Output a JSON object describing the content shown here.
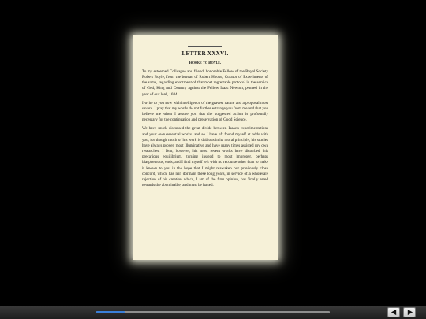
{
  "page": {
    "title": "LETTER XXXVI.",
    "subtitle": "Hooke to Boyle.",
    "paragraphs": [
      "To my esteemed Colleague and friend, honorable Fellow of the Royal Society Robert Boyle, from the bureau of Robert Hooke, Curator of Experiments of the same, regarding enactment of that most regrettable protocol in the service of God, King and Country against the Fellow Isaac Newton, penned in the year of our lord, 1684.",
      "I write to you now with intelligence of the gravest nature and a proposal most severe. I pray that my words do not further estrange you from me and that you believe me when I assure you that the suggested action is profoundly necessary for the continuation and preservation of Good Science.",
      "We have much discussed the great divide between Isaac's experimentations and your own essential works, and so I have oft found myself at odds with you, for though much of his work is dubious in its moral principle, his studies have always proven most illuminative and have many times assisted my own researches. I fear, however, his most recent works have disturbed this precarious equilibrium, turning instead to most improper, perhaps blasphemous, ends; and I find myself left with no recourse other than to make it known to you in the hope that I might reawaken our previously close concord, which has lain dormant these long years, in service of a wholesale rejection of his creation which, I am of the firm opinion, has finally erred towards the abominable, and must be halted."
    ]
  },
  "toolbar": {
    "progress_fraction": 0.12,
    "progress_color": "#3a7fd9",
    "prev_icon": "triangle-left-icon",
    "next_icon": "triangle-right-icon"
  }
}
